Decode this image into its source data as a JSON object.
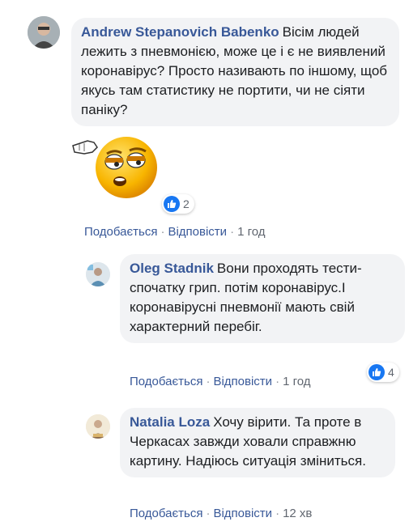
{
  "comments": [
    {
      "author": "Andrew Stepanovich Babenko",
      "text": "Вісім людей лежить з пневмонією, може це і є не виявлений коронавірус? Просто називають по іншому, щоб якусь там статистику не портити, чи не сіяти паніку?",
      "reaction_count": "2",
      "like_label": "Подобається",
      "reply_label": "Відповісти",
      "time": "1 год",
      "sticker_icon": "pointing-emoji-sticker"
    },
    {
      "author": "Oleg Stadnik",
      "text": "Вони проходять тести- спочатку грип. потім коронавірус.І коронавірусні пневмонії мають свій характерний перебіг.",
      "reaction_count": "4",
      "like_label": "Подобається",
      "reply_label": "Відповісти",
      "time": "1 год"
    },
    {
      "author": "Natalia Loza",
      "text": "Хочу вірити. Та проте в Черкасах завжди ховали справжню картину. Надіюсь ситуація зміниться.",
      "like_label": "Подобається",
      "reply_label": "Відповісти",
      "time": "12 хв"
    }
  ],
  "separator": "·",
  "colors": {
    "author": "#385898",
    "bubble": "#f2f3f5",
    "like_blue": "#1877f2"
  }
}
